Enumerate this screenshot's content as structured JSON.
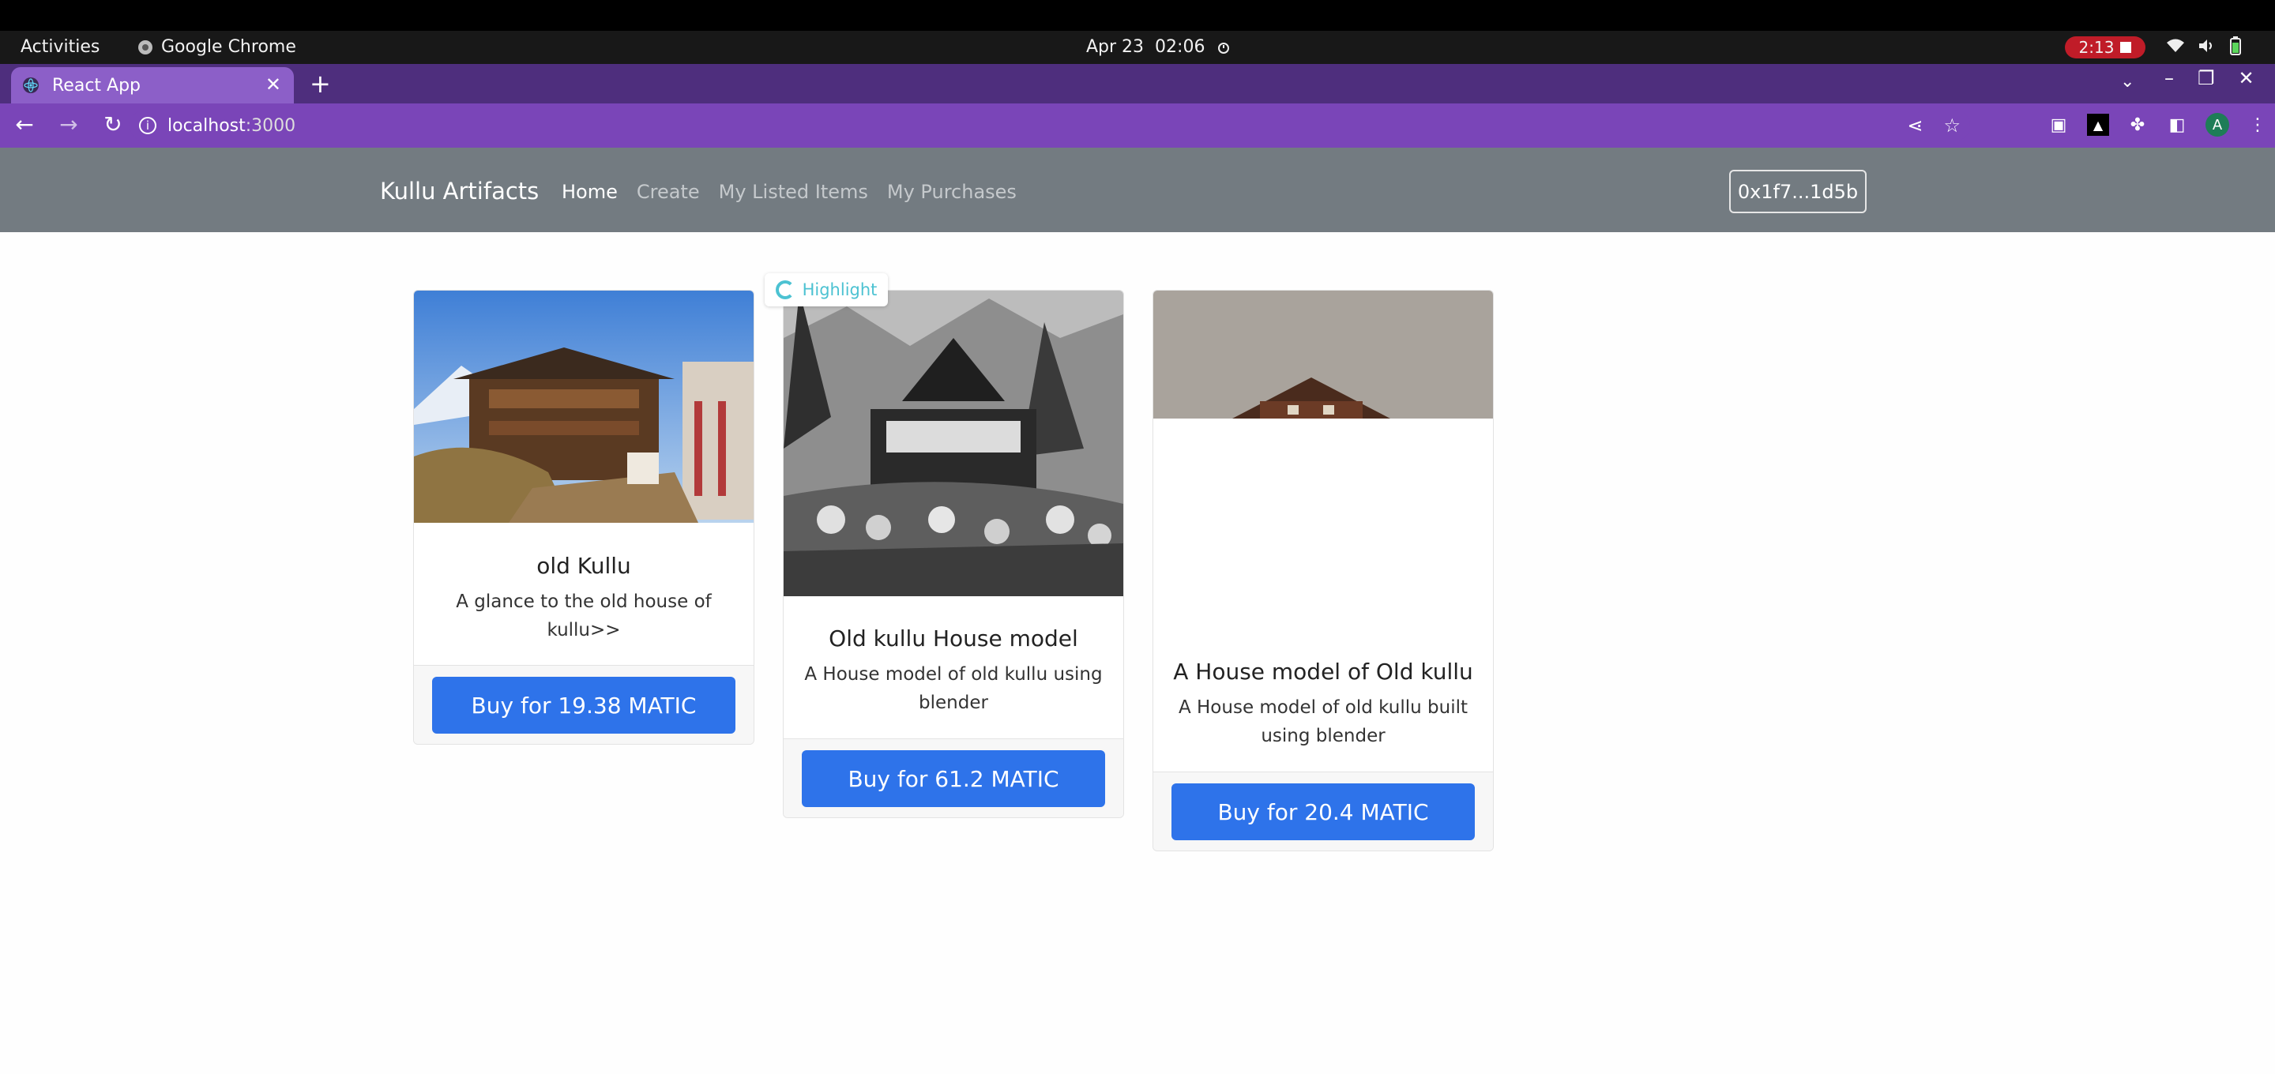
{
  "os_bar": {
    "activities": "Activities",
    "app_name": "Google Chrome",
    "date": "Apr 23",
    "time": "02:06",
    "recording_time": "2:13"
  },
  "browser": {
    "tab_title": "React App",
    "url_host": "localhost",
    "url_port": ":3000"
  },
  "app_nav": {
    "brand": "Kullu Artifacts",
    "links": [
      "Home",
      "Create",
      "My Listed Items",
      "My Purchases"
    ],
    "account": "0x1f7...1d5b"
  },
  "highlight_label": "Highlight",
  "items": [
    {
      "name": "old Kullu",
      "description": "A glance to the old house of kullu>>",
      "buy_label": "Buy for 19.38 MATIC"
    },
    {
      "name": "Old kullu House model",
      "description": "A House model of old kullu using blender",
      "buy_label": "Buy for 61.2 MATIC"
    },
    {
      "name": "A House model of Old kullu",
      "description": "A House model of old kullu built using blender",
      "buy_label": "Buy for 20.4 MATIC"
    }
  ],
  "colors": {
    "navbar": "#737b81",
    "buy_button": "#2e73ea",
    "tab_active": "#8c5fc8",
    "address_bar": "#7a45b8"
  }
}
